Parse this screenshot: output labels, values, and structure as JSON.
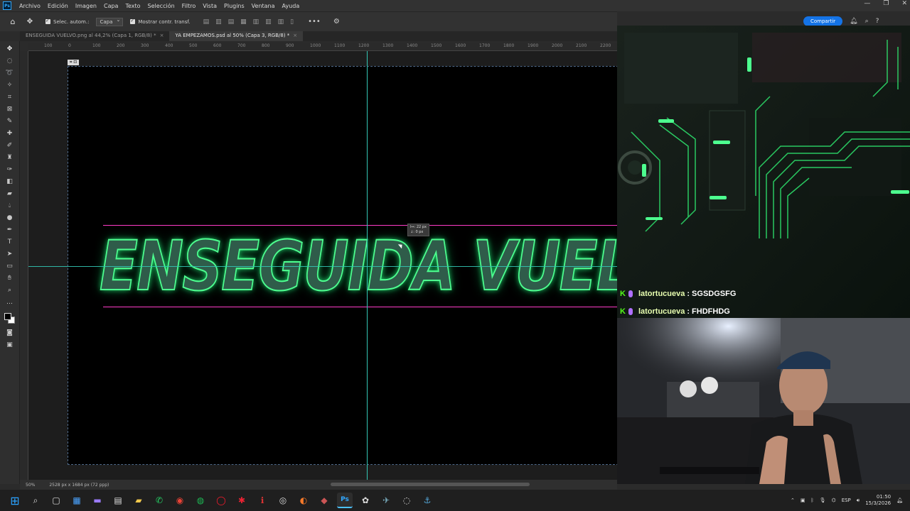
{
  "menu": {
    "app_icon": "ps-logo",
    "items": [
      "Archivo",
      "Edición",
      "Imagen",
      "Capa",
      "Texto",
      "Selección",
      "Filtro",
      "Vista",
      "Plugins",
      "Ventana",
      "Ayuda"
    ]
  },
  "options": {
    "auto_select_label": "Selec. autom.:",
    "auto_select_value": "Capa",
    "transform_label": "Mostrar contr. transf.",
    "more": "•••"
  },
  "topright": {
    "share_label": "Compartir"
  },
  "tabs": [
    {
      "label": "ENSEGUIDA VUELVO.png al 44,2% (Capa 1, RGB/8) *",
      "active": false
    },
    {
      "label": "YA EMPEZAMOS.psd al 50% (Capa 3, RGB/8) *",
      "active": true
    }
  ],
  "ruler": {
    "labels": [
      "100",
      "0",
      "100",
      "200",
      "300",
      "400",
      "500",
      "600",
      "700",
      "800",
      "900",
      "1000",
      "1100",
      "1200",
      "1300",
      "1400",
      "1500",
      "1600",
      "1700",
      "1800",
      "1900",
      "2000",
      "2100",
      "2200"
    ]
  },
  "canvas": {
    "artboard_label": "Capa",
    "headline": "ENSEGUIDA VUELVO",
    "measure_line1": "l↔: 22 px",
    "measure_line2": "↓: 0 px"
  },
  "status": {
    "zoom": "50%",
    "doc_info": "2528 px x 1684 px (72 ppp)"
  },
  "chat": [
    {
      "user": "latortucueva",
      "message": "SGSDGSFG"
    },
    {
      "user": "latortucueva",
      "message": "FHDFHDG"
    }
  ],
  "taskbar": {
    "lang": "ESP",
    "time": "01:50",
    "date": "15/3/2026"
  },
  "colors": {
    "accent_blue": "#1473e6",
    "guide": "#33c7b5",
    "neon_green": "#4dff8f",
    "kick_green": "#53fc18"
  }
}
